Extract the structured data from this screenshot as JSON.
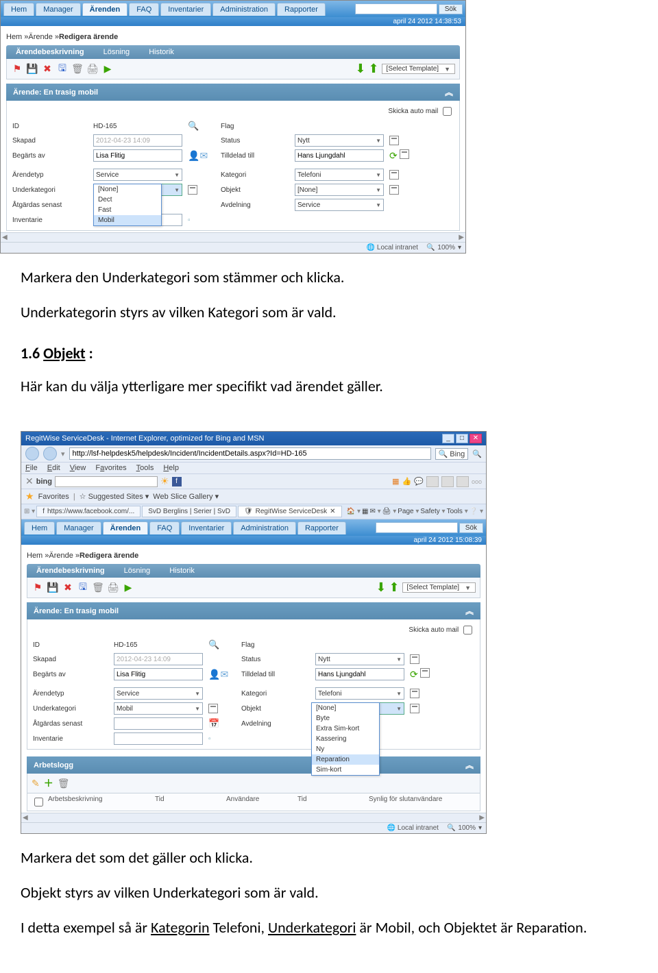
{
  "screenshot1": {
    "appnav": {
      "tabs": [
        "Hem",
        "Manager",
        "Ärenden",
        "FAQ",
        "Inventarier",
        "Administration",
        "Rapporter"
      ],
      "active": "Ärenden",
      "searchBtn": "Sök"
    },
    "datebar": "april 24 2012 14:38:53",
    "crumb": {
      "pre": "Hem »Ärende »",
      "last": "Redigera ärende"
    },
    "subnav": {
      "items": [
        "Ärendebeskrivning",
        "Lösning",
        "Historik"
      ],
      "active": "Ärendebeskrivning"
    },
    "template": "[Select Template]",
    "panelTitle": "Ärende: En trasig mobil",
    "autoMail": "Skicka auto mail",
    "fields1": {
      "id_lbl": "ID",
      "id_val": "HD-165",
      "flag_lbl": "Flag",
      "skapad_lbl": "Skapad",
      "skapad_val": "2012-04-23 14:09",
      "status_lbl": "Status",
      "status_val": "Nytt",
      "begarts_lbl": "Begärts av",
      "begarts_val": "Lisa Flitig",
      "tilldelad_lbl": "Tilldelad till",
      "tilldelad_val": "Hans Ljungdahl"
    },
    "fields2": {
      "arendetyp_lbl": "Ärendetyp",
      "arendetyp_val": "Service",
      "kategori_lbl": "Kategori",
      "kategori_val": "Telefoni",
      "underkat_lbl": "Underkategori",
      "underkat_val": "[None]",
      "objekt_lbl": "Objekt",
      "objekt_val": "[None]",
      "atg_lbl": "Åtgärdas senast",
      "avd_lbl": "Avdelning",
      "avd_val": "Service",
      "inv_lbl": "Inventarie"
    },
    "dropdown": [
      "[None]",
      "Dect",
      "Fast",
      "Mobil"
    ],
    "dropdownHighlight": "Mobil",
    "status": {
      "intranet": "Local intranet",
      "zoom": "100%"
    }
  },
  "text": {
    "p1": "Markera den Underkategori som stämmer och klicka.",
    "p2": "Underkategorin styrs av vilken Kategori som är vald.",
    "h_num": "1.6  ",
    "h_txt": "Objekt",
    "h_suf": " :",
    "p3": "Här kan du välja ytterligare mer specifikt vad ärendet gäller.",
    "p4": "Markera det som det gäller och klicka.",
    "p5": "Objekt styrs av vilken Underkategori som är vald.",
    "p6a": "I detta exempel så är ",
    "p6b": "Kategorin",
    "p6c": " Telefoni, ",
    "p6d": "Underkategori",
    "p6e": " är Mobil, och Objektet är Reparation."
  },
  "screenshot2": {
    "titlebar": "RegitWise ServiceDesk - Internet Explorer, optimized for Bing and MSN",
    "url": "http://lsf-helpdesk5/helpdesk/Incident/IncidentDetails.aspx?Id=HD-165",
    "searchEngine": "Bing",
    "menus": [
      "File",
      "Edit",
      "View",
      "Favorites",
      "Tools",
      "Help"
    ],
    "bingbar": {
      "bing": "bing",
      "ooo": "ooo"
    },
    "favbar": {
      "fav": "Favorites",
      "sug": "Suggested Sites",
      "web": "Web Slice Gallery"
    },
    "browserTabs": [
      "https://www.facebook.com/...",
      "SvD Berglins | Serier | SvD",
      "RegitWise ServiceDesk"
    ],
    "browserTabActive": "RegitWise ServiceDesk",
    "browserTools": [
      "Page",
      "Safety",
      "Tools"
    ],
    "appnav": {
      "tabs": [
        "Hem",
        "Manager",
        "Ärenden",
        "FAQ",
        "Inventarier",
        "Administration",
        "Rapporter"
      ],
      "active": "Ärenden",
      "searchBtn": "Sök"
    },
    "datebar": "april 24 2012 15:08:39",
    "crumb": {
      "pre": "Hem »Ärende »",
      "last": "Redigera ärende"
    },
    "subnav": {
      "items": [
        "Ärendebeskrivning",
        "Lösning",
        "Historik"
      ],
      "active": "Ärendebeskrivning"
    },
    "template": "[Select Template]",
    "panelTitle": "Ärende: En trasig mobil",
    "autoMail": "Skicka auto mail",
    "fields1": {
      "id_lbl": "ID",
      "id_val": "HD-165",
      "flag_lbl": "Flag",
      "skapad_lbl": "Skapad",
      "skapad_val": "2012-04-23 14:09",
      "status_lbl": "Status",
      "status_val": "Nytt",
      "begarts_lbl": "Begärts av",
      "begarts_val": "Lisa Flitig",
      "tilldelad_lbl": "Tilldelad till",
      "tilldelad_val": "Hans Ljungdahl"
    },
    "fields2": {
      "arendetyp_lbl": "Ärendetyp",
      "arendetyp_val": "Service",
      "kategori_lbl": "Kategori",
      "kategori_val": "Telefoni",
      "underkat_lbl": "Underkategori",
      "underkat_val": "Mobil",
      "objekt_lbl": "Objekt",
      "objekt_val": "None",
      "atg_lbl": "Åtgärdas senast",
      "avd_lbl": "Avdelning",
      "inv_lbl": "Inventarie"
    },
    "objektDropdown": [
      "[None]",
      "Byte",
      "Extra Sim-kort",
      "Kassering",
      "Ny",
      "Reparation",
      "Sim-kort"
    ],
    "objektHighlight": "Reparation",
    "arbetslogg": {
      "title": "Arbetslogg",
      "cols": [
        "Arbetsbeskrivning",
        "Tid",
        "Användare",
        "Tid",
        "Synlig för slutanvändare"
      ]
    },
    "status": {
      "intranet": "Local intranet",
      "zoom": "100%"
    }
  }
}
